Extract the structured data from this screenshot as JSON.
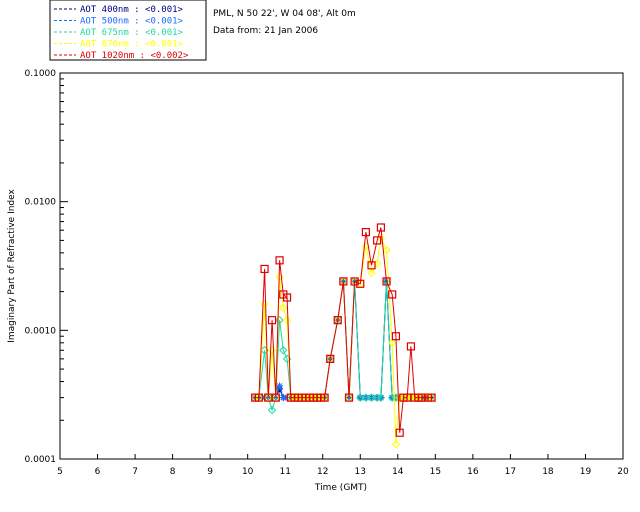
{
  "info": {
    "location": "PML, N 50 22', W 04 08', Alt 0m",
    "date": "Data from: 21 Jan 2006"
  },
  "chart_data": {
    "type": "line",
    "xlabel": "Time (GMT)",
    "ylabel": "Imaginary Part of Refractive Index",
    "xlim": [
      5,
      20
    ],
    "ylim": [
      0.0001,
      0.1
    ],
    "yscale": "log",
    "x_ticks": [
      5,
      6,
      7,
      8,
      9,
      10,
      11,
      12,
      13,
      14,
      15,
      16,
      17,
      18,
      19,
      20
    ],
    "y_ticks": [
      {
        "value": 0.0001,
        "label": "0.0001"
      },
      {
        "value": 0.001,
        "label": "0.0010"
      },
      {
        "value": 0.01,
        "label": "0.0100"
      },
      {
        "value": 0.1,
        "label": "0.1000"
      }
    ],
    "legend_position": "top-left, outside plot",
    "x": [
      10.2,
      10.3,
      10.45,
      10.55,
      10.65,
      10.75,
      10.85,
      10.95,
      11.05,
      11.15,
      11.25,
      11.35,
      11.45,
      11.55,
      11.65,
      11.75,
      11.85,
      11.95,
      12.05,
      12.2,
      12.4,
      12.55,
      12.7,
      12.85,
      13.0,
      13.15,
      13.3,
      13.45,
      13.55,
      13.7,
      13.85,
      13.95,
      14.05,
      14.15,
      14.25,
      14.35,
      14.45,
      14.55,
      14.65,
      14.8,
      14.9
    ],
    "series": [
      {
        "name": "AOT  400nm : <0.001>",
        "color": "#000080",
        "marker": "star",
        "values": [
          0.0003,
          0.0003,
          0.0003,
          0.0003,
          0.0003,
          0.0003,
          0.00035,
          0.0003,
          0.0003,
          0.0003,
          0.0003,
          0.0003,
          0.0003,
          0.0003,
          0.0003,
          0.0003,
          0.0003,
          0.0003,
          0.0003,
          0.0006,
          0.0012,
          0.0024,
          0.0003,
          0.0024,
          0.0003,
          0.0003,
          0.0003,
          0.0003,
          0.0003,
          0.0024,
          0.0003,
          0.0003,
          0.0003,
          0.0003,
          0.0003,
          0.0003,
          0.0003,
          0.0003,
          0.0003,
          0.0003,
          0.0003
        ]
      },
      {
        "name": "AOT  500nm : <0.001>",
        "color": "#1a6cff",
        "marker": "star",
        "values": [
          0.0003,
          0.0003,
          0.0003,
          0.0003,
          0.0003,
          0.0003,
          0.00037,
          0.0003,
          0.0003,
          0.0003,
          0.0003,
          0.0003,
          0.0003,
          0.0003,
          0.0003,
          0.0003,
          0.0003,
          0.0003,
          0.0003,
          0.0006,
          0.0012,
          0.0024,
          0.0003,
          0.0024,
          0.0003,
          0.0003,
          0.0003,
          0.0003,
          0.0003,
          0.0024,
          0.0003,
          0.0003,
          0.0003,
          0.0003,
          0.0003,
          0.0003,
          0.0003,
          0.0003,
          0.0003,
          0.0003,
          0.0003
        ]
      },
      {
        "name": "AOT  675nm : <0.001>",
        "color": "#20d8a0",
        "marker": "diamond",
        "values": [
          0.0003,
          0.0003,
          0.0007,
          0.0003,
          0.00024,
          0.0003,
          0.0012,
          0.0007,
          0.0006,
          0.0003,
          0.0003,
          0.0003,
          0.0003,
          0.0003,
          0.0003,
          0.0003,
          0.0003,
          0.0003,
          0.0003,
          0.0006,
          0.0012,
          0.0024,
          0.0003,
          0.0024,
          0.0003,
          0.0003,
          0.0003,
          0.0003,
          0.0003,
          0.0024,
          0.0003,
          0.0003,
          0.0003,
          0.0003,
          0.0003,
          0.0003,
          0.0003,
          0.0003,
          0.0003,
          0.0003,
          0.0003
        ]
      },
      {
        "name": "AOT  870nm : <0.001>",
        "color": "#ffff00",
        "marker": "diamond",
        "values": [
          0.0003,
          0.0003,
          0.0016,
          0.0003,
          0.0007,
          0.0003,
          0.0026,
          0.0015,
          0.0012,
          0.0003,
          0.0003,
          0.0003,
          0.0003,
          0.0003,
          0.0003,
          0.0003,
          0.0003,
          0.0003,
          0.0003,
          0.0006,
          0.0012,
          0.0024,
          0.0003,
          0.0024,
          0.0023,
          0.0045,
          0.0028,
          0.0033,
          0.0052,
          0.0042,
          0.0008,
          0.00013,
          0.0003,
          0.0003,
          0.0003,
          0.0003,
          0.0003,
          0.0003,
          0.0003,
          0.0003,
          0.0003
        ]
      },
      {
        "name": "AOT 1020nm : <0.002>",
        "color": "#e00000",
        "marker": "square",
        "values": [
          0.0003,
          0.0003,
          0.003,
          0.0003,
          0.0012,
          0.0003,
          0.0035,
          0.0019,
          0.0018,
          0.0003,
          0.0003,
          0.0003,
          0.0003,
          0.0003,
          0.0003,
          0.0003,
          0.0003,
          0.0003,
          0.0003,
          0.0006,
          0.0012,
          0.0024,
          0.0003,
          0.0024,
          0.0023,
          0.0058,
          0.0032,
          0.005,
          0.0063,
          0.0024,
          0.0019,
          0.0009,
          0.00016,
          0.0003,
          0.0003,
          0.00075,
          0.0003,
          0.0003,
          0.0003,
          0.0003,
          0.0003
        ]
      }
    ]
  }
}
